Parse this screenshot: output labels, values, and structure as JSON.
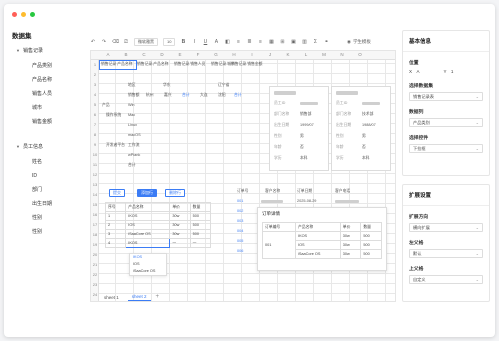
{
  "colors": {
    "red": "#ff5f57",
    "yellow": "#febc2e",
    "green": "#28c840",
    "accent": "#3b7cf5"
  },
  "left": {
    "title": "数据集",
    "groups": [
      {
        "label": "销售记录",
        "items": [
          "产品类别",
          "产品名称",
          "销售人员",
          "城市",
          "销售金额"
        ]
      },
      {
        "label": "员工信息",
        "items": [
          "姓名",
          "ID",
          "部门",
          "出生日期",
          "性别",
          "性别"
        ]
      }
    ]
  },
  "toolbar": {
    "font_select": "微软雅黑",
    "size_select": "10",
    "preview": "学生模板"
  },
  "sheet": {
    "columns": [
      "A",
      "B",
      "C",
      "D",
      "E",
      "F",
      "G",
      "H",
      "I",
      "J",
      "K",
      "L",
      "M",
      "N",
      "O"
    ],
    "rows": [
      "1",
      "2",
      "3",
      "4",
      "5",
      "6",
      "7",
      "8",
      "9",
      "10",
      "11",
      "12",
      "13",
      "14",
      "15",
      "16",
      "17",
      "18",
      "19",
      "20",
      "21",
      "22",
      "23",
      "24",
      "25"
    ],
    "template_row": [
      "销售记录 产品名称",
      "销售记录.产品名称",
      "销售记录.销售人员",
      "销售记录.城市",
      "销售记录.销售金额"
    ],
    "matrix": {
      "headers": [
        "地区",
        "华北",
        "华东",
        "辽宁省"
      ],
      "sub": [
        "销售额",
        "杭州",
        "嘉兴",
        "合计",
        "大连",
        "沈阳",
        "合计"
      ],
      "categories": [
        "产品",
        "操作系统",
        "开发者平台"
      ],
      "rows": [
        "Win",
        "Mac",
        "Linux",
        "macOS",
        "工作流",
        "wPlank",
        "合计"
      ]
    },
    "cards": [
      {
        "rows": [
          "员工ID",
          "部门名称",
          "出生日期",
          "性别",
          "年龄",
          "学历"
        ],
        "values": [
          "销售部",
          "1999/07",
          "男",
          "否",
          "本科"
        ]
      },
      {
        "rows": [
          "员工ID",
          "部门名称",
          "出生日期",
          "性别",
          "年龄",
          "学历"
        ],
        "values": [
          "技术部",
          "1988/07",
          "男",
          "否",
          "本科"
        ]
      }
    ],
    "buttons": {
      "submit": "提交",
      "add_row": "添加行",
      "delete_row": "删除行"
    },
    "entry_table": {
      "headers": [
        "序号",
        "产品名称",
        "单价",
        "数量"
      ],
      "rows": [
        [
          "1",
          "IKOS",
          "30w",
          "500"
        ],
        [
          "2",
          "IOS",
          "30w",
          "500"
        ],
        [
          "3",
          "iSaaCore OS",
          "30w",
          "500"
        ],
        [
          "4",
          "IKOS",
          "一",
          "一"
        ]
      ]
    },
    "dropdown": [
      "IKOS",
      "IOS",
      "iSaaCore OS"
    ],
    "order_header": [
      "订单号",
      "客户名称",
      "订单日期",
      "客户电话"
    ],
    "order_date": "2025-08-29",
    "order_ids": [
      "001",
      "002",
      "003",
      "004",
      "005",
      "006"
    ],
    "order_detail": {
      "title": "订单详情",
      "headers": [
        "订单编号",
        "产品名称",
        "单价",
        "数量"
      ],
      "order_id": "001",
      "rows": [
        [
          "IKOS",
          "30w",
          "500"
        ],
        [
          "IOS",
          "30w",
          "500"
        ],
        [
          "iSaaCore OS",
          "30w",
          "500"
        ]
      ]
    }
  },
  "tabs": {
    "sheet1": "sheet 1",
    "sheet2": "sheet 2"
  },
  "basic_panel": {
    "title": "基本信息",
    "position_label": "位置",
    "x": "X　A",
    "y": "Y　1",
    "dataset_label": "选择数据集",
    "dataset_value": "销售记录表",
    "column_label": "数据列",
    "column_value": "产品类别",
    "control_label": "选择控件",
    "control_value": "下拉框"
  },
  "expand_panel": {
    "title": "扩展设置",
    "direction_label": "扩展方向",
    "direction_value": "横向扩展",
    "left_parent_label": "左父格",
    "left_parent_value": "默认",
    "top_parent_label": "上父格",
    "top_parent_value": "自定义"
  }
}
